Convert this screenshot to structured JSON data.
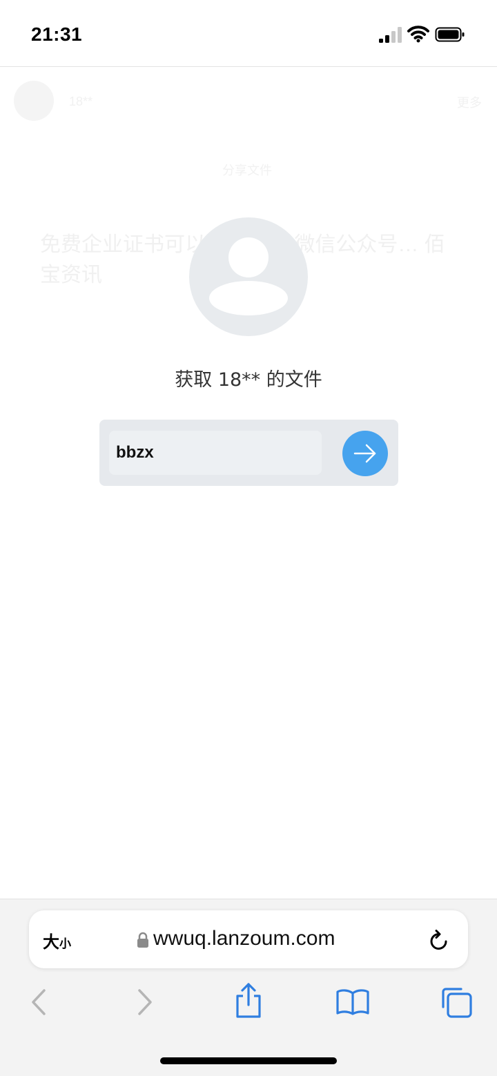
{
  "status_bar": {
    "time": "21:31",
    "icons": [
      "cellular-signal-icon",
      "wifi-icon",
      "battery-icon"
    ]
  },
  "background_page": {
    "username": "18**",
    "more": "更多",
    "label": "分享文件",
    "text": "免费企业证书可以… 请关注微信公众号… 佰宝资讯"
  },
  "dialog": {
    "title": "获取 18** 的文件",
    "code_value": "bbzx",
    "submit_icon": "arrow-right-icon",
    "accent_color": "#46a3ee"
  },
  "browser": {
    "text_size_big": "大",
    "text_size_small": "小",
    "url": "wwuq.lanzoum.com",
    "toolbar": [
      "back-icon",
      "forward-icon",
      "share-icon",
      "bookmarks-icon",
      "tabs-icon"
    ],
    "link_color": "#2f7ee0"
  }
}
